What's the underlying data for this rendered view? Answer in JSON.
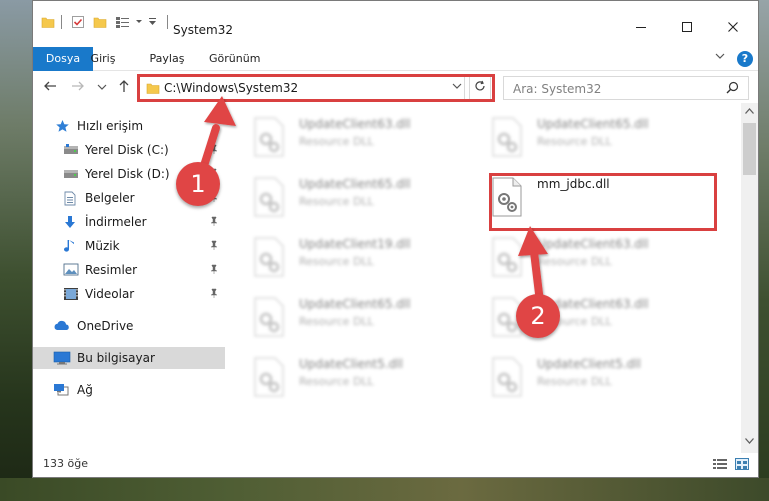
{
  "window": {
    "title": "System32"
  },
  "ribbon": {
    "tabs": [
      {
        "label": "Dosya"
      },
      {
        "label": "Giriş"
      },
      {
        "label": "Paylaş"
      },
      {
        "label": "Görünüm"
      }
    ],
    "help_label": "?"
  },
  "navigation": {
    "address": "C:\\Windows\\System32",
    "search_placeholder": "Ara: System32"
  },
  "sidebar": {
    "items": [
      {
        "label": "Hızlı erişim",
        "icon": "star-icon"
      },
      {
        "label": "Yerel Disk (C:)",
        "icon": "drive-icon",
        "pinned": true
      },
      {
        "label": "Yerel Disk (D:)",
        "icon": "drive-icon",
        "pinned": true
      },
      {
        "label": "Belgeler",
        "icon": "documents-icon",
        "pinned": true
      },
      {
        "label": "İndirmeler",
        "icon": "download-icon",
        "pinned": true
      },
      {
        "label": "Müzik",
        "icon": "music-icon",
        "pinned": true
      },
      {
        "label": "Resimler",
        "icon": "pictures-icon",
        "pinned": true
      },
      {
        "label": "Videolar",
        "icon": "videos-icon",
        "pinned": true
      },
      {
        "label": "OneDrive",
        "icon": "cloud-icon"
      },
      {
        "label": "Bu bilgisayar",
        "icon": "computer-icon",
        "selected": true
      },
      {
        "label": "Ağ",
        "icon": "network-icon"
      }
    ]
  },
  "files": [
    {
      "name": "UpdateClient63.dll",
      "desc": "Resource DLL",
      "blurred": true
    },
    {
      "name": "UpdateClient65.dll",
      "desc": "Resource DLL",
      "blurred": true
    },
    {
      "name": "UpdateClient65.dll",
      "desc": "Resource DLL",
      "blurred": true
    },
    {
      "name": "mm_jdbc.dll",
      "desc": "",
      "blurred": false
    },
    {
      "name": "UpdateClient19.dll",
      "desc": "Resource DLL",
      "blurred": true
    },
    {
      "name": "UpdateClient63.dll",
      "desc": "Resource DLL",
      "blurred": true
    },
    {
      "name": "UpdateClient65.dll",
      "desc": "Resource DLL",
      "blurred": true
    },
    {
      "name": "UpdateClient63.dll",
      "desc": "Resource DLL",
      "blurred": true
    },
    {
      "name": "UpdateClient5.dll",
      "desc": "Resource DLL",
      "blurred": true
    },
    {
      "name": "UpdateClient5.dll",
      "desc": "Resource DLL",
      "blurred": true
    }
  ],
  "status": {
    "item_count": "133 öğe"
  },
  "annotations": {
    "step1": "1",
    "step2": "2",
    "color": "#e04545"
  },
  "colors": {
    "accent": "#1979ca",
    "highlight": "#d94040"
  }
}
